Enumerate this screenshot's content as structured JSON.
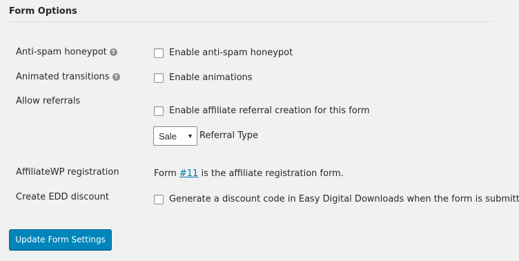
{
  "section": {
    "title": "Form Options"
  },
  "rows": {
    "honeypot": {
      "label": "Anti-spam honeypot",
      "help_icon": "?",
      "checkbox_label": "Enable anti-spam honeypot",
      "checked": false
    },
    "animations": {
      "label": "Animated transitions",
      "help_icon": "?",
      "checkbox_label": "Enable animations",
      "checked": false
    },
    "referrals": {
      "label": "Allow referrals",
      "checkbox_label": "Enable affiliate referral creation for this form",
      "checked": false,
      "referral_type": {
        "selected": "Sale",
        "label": "Referral Type"
      }
    },
    "affiliatewp": {
      "label": "AffiliateWP registration",
      "text_before": "Form ",
      "link_text": "#11",
      "text_after": " is the affiliate registration form."
    },
    "edd_discount": {
      "label": "Create EDD discount",
      "checkbox_label": "Generate a discount code in Easy Digital Downloads when the form is submitted",
      "checked": false
    }
  },
  "actions": {
    "submit_label": "Update Form Settings"
  },
  "colors": {
    "background": "#f1f1f1",
    "primary_button": "#0085ba",
    "link": "#0073aa",
    "text": "#23282d"
  },
  "icons": {
    "help": "help-icon",
    "dropdown": "chevron-down-icon"
  }
}
